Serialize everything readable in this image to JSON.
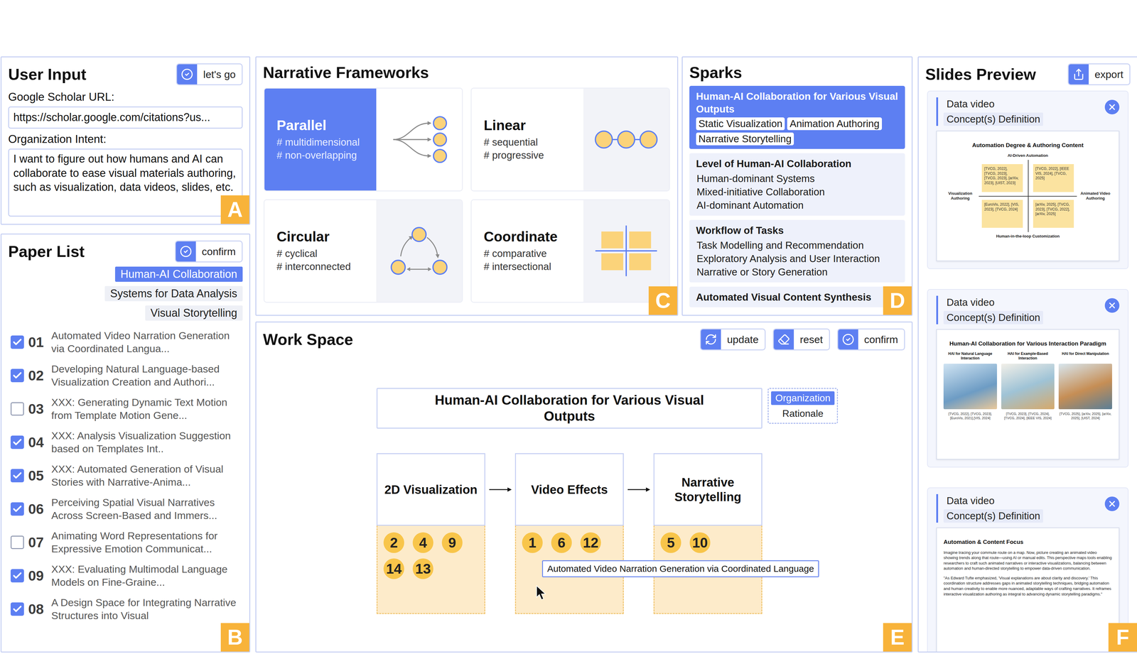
{
  "user_input": {
    "title": "User Input",
    "button": "let's go",
    "badge": "A",
    "fields": [
      {
        "label": "Google Scholar URL:",
        "value": "https://scholar.google.com/citations?us...",
        "kind": "line"
      },
      {
        "label": "Organization Intent:",
        "value": "I want to figure out how humans and AI can collaborate to ease visual materials authoring, such as visualization, data videos, slides, etc.",
        "kind": "area"
      }
    ]
  },
  "paper_list": {
    "title": "Paper List",
    "button": "confirm",
    "badge": "B",
    "tags": [
      {
        "label": "Human-AI Collaboration",
        "selected": true
      },
      {
        "label": "Systems for Data Analysis",
        "selected": false
      },
      {
        "label": "Visual Storytelling",
        "selected": false
      }
    ],
    "papers": [
      {
        "number": "01",
        "title": "Automated Video Narration Generation via Coordinated Langua...",
        "checked": true
      },
      {
        "number": "02",
        "title": "Developing Natural Language-based Visualization Creation and Authori...",
        "checked": true
      },
      {
        "number": "03",
        "title": "XXX: Generating Dynamic Text Motion from Template Motion Gene...",
        "checked": false
      },
      {
        "number": "04",
        "title": "XXX: Analysis Visualization Suggestion based on Templates Int..",
        "checked": true
      },
      {
        "number": "05",
        "title": "XXX: Automated Generation of Visual Stories with Narrative-Anima...",
        "checked": true
      },
      {
        "number": "06",
        "title": "Perceiving Spatial Visual Narratives Across Screen-Based and Immers...",
        "checked": true
      },
      {
        "number": "07",
        "title": "Animating Word Representations for Expressive Emotion Communicat...",
        "checked": false
      },
      {
        "number": "09",
        "title": "XXX: Evaluating Multimodal Language Models on Fine-Graine...",
        "checked": true
      },
      {
        "number": "08",
        "title": "A Design Space for Integrating Narrative Structures into Visual",
        "checked": true
      }
    ]
  },
  "frameworks": {
    "title": "Narrative Frameworks",
    "badge": "C",
    "items": [
      {
        "name": "Parallel",
        "tags": [
          "# multidimensional",
          "# non-overlapping"
        ],
        "selected": true,
        "kind": "parallel"
      },
      {
        "name": "Linear",
        "tags": [
          "# sequential",
          "# progressive"
        ],
        "selected": false,
        "kind": "linear"
      },
      {
        "name": "Circular",
        "tags": [
          "# cyclical",
          "# interconnected"
        ],
        "selected": false,
        "kind": "circular"
      },
      {
        "name": "Coordinate",
        "tags": [
          "# comparative",
          "# intersectional"
        ],
        "selected": false,
        "kind": "coordinate"
      }
    ]
  },
  "sparks": {
    "title": "Sparks",
    "badge": "D",
    "groups": [
      {
        "title": "Human-AI Collaboration for Various Visual Outputs",
        "items": [
          "Static Visualization",
          "Animation Authoring",
          "Narrative Storytelling"
        ],
        "selected": true
      },
      {
        "title": "Level of Human-AI Collaboration",
        "items": [
          "Human-dominant Systems",
          "Mixed-initiative Collaboration",
          "AI-dominant Automation"
        ],
        "selected": false
      },
      {
        "title": "Workflow of Tasks",
        "items": [
          "Task Modelling and Recommendation",
          "Exploratory Analysis and User Interaction",
          "Narrative or Story Generation"
        ],
        "selected": false
      },
      {
        "title": "Automated Visual Content Synthesis",
        "items": [],
        "selected": false
      }
    ]
  },
  "workspace": {
    "title": "Work Space",
    "badge": "E",
    "buttons": [
      "update",
      "reset",
      "confirm"
    ],
    "root": "Human-AI Collaboration for Various Visual Outputs",
    "tabs": [
      {
        "label": "Organization",
        "selected": true
      },
      {
        "label": "Rationale",
        "selected": false
      }
    ],
    "nodes": [
      {
        "label": "2D Visualization",
        "papers": [
          "2",
          "4",
          "9",
          "14",
          "13"
        ]
      },
      {
        "label": "Video Effects",
        "papers": [
          "1",
          "6",
          "12"
        ]
      },
      {
        "label": "Narrative Storytelling",
        "papers": [
          "5",
          "10"
        ]
      }
    ],
    "tooltip": "Automated Video Narration Generation via Coordinated Language"
  },
  "slides": {
    "title": "Slides Preview",
    "button": "export",
    "badge": "F",
    "cards": [
      {
        "tags": [
          "Data video",
          "Concept(s) Definition"
        ],
        "kind": "quadrant",
        "title": "Automation Degree & Authoring Content",
        "axes": {
          "top": "AI-Driven Automation",
          "bottom": "Human-in-the-loop Customization",
          "left": "Visualization Authoring",
          "right": "Animated Video Authoring"
        },
        "cells": [
          "[TVCG, 2022], [TVCG, 2023], [TVCG, 2023], [arXiv, 2023], [UIST, 2023]",
          "[TVCG, 2022], [IEEE VIS, 2024], [TVCG, 2025]",
          "[EuroVis, 2022], [VIS, 2023], [TVCG, 2024]",
          "[arXiv, 2025], [TVCG, 2023], [TVCG, 2022], [arXiv, 2025]"
        ]
      },
      {
        "tags": [
          "Data video",
          "Concept(s) Definition"
        ],
        "kind": "columns",
        "title": "Human-AI Collaboration for Various Interaction Paradigm",
        "columns": [
          {
            "label": "HAI for Natural Language Interaction",
            "refs": "[TVCG, 2022], [TVCG, 2023], [EuroVis, 2021],[VIS, 2024]"
          },
          {
            "label": "HAI for Example-Based Interaction",
            "refs": "[TVCG, 2023], [TVCG, 2024], [TVCG, 2024], [IEEE VIS, 2024]"
          },
          {
            "label": "HAI for Direct Manipulation",
            "refs": "[TVCG, 2025], [arXiv, 2025], [arXiv, 2025], [UIST, 2024]"
          }
        ]
      },
      {
        "tags": [
          "Data video",
          "Concept(s) Definition"
        ],
        "kind": "text",
        "title": "Automation & Content Focus",
        "paragraphs": [
          "Imagine tracing your commute route on a map. Now, picture creating an animated video showing trends along that route—using AI or manual edits. This perspective maps tools enabling researchers to craft such animated narratives or interactive visualizations, balancing between automation and human-directed storytelling to empower data-driven communication.",
          "\"As Edward Tufte emphasized, 'Visual explanations are about clarity and discovery.' This coordination structure addresses gaps in animated storytelling techniques, bridging automation and human creativity to enable more nuanced, adaptable ways of crafting narratives. It reframes interactive visualization authoring as integral to advancing dynamic storytelling paradigms.\""
        ]
      }
    ]
  }
}
